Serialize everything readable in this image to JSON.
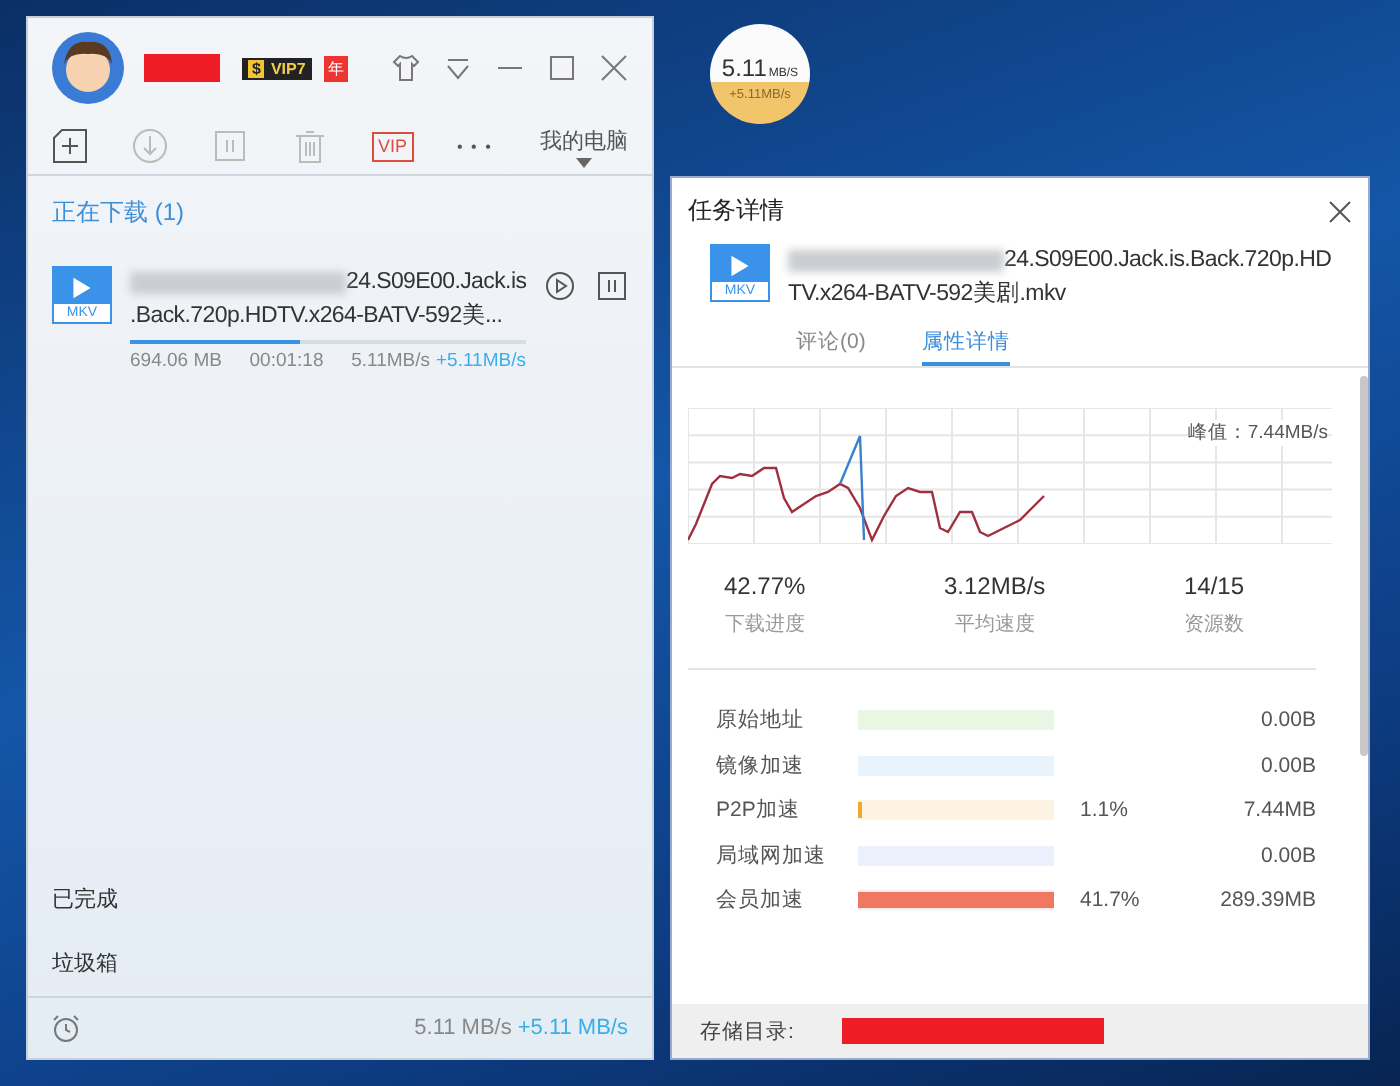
{
  "main_window": {
    "user": {
      "vip_symbol": "$",
      "vip_badge": "VIP7",
      "year_badge": "年"
    },
    "toolbar": {
      "vip_label": "VIP",
      "more": "• • •",
      "pc_label": "我的电脑"
    },
    "section_title": "正在下载 (1)",
    "task": {
      "file_type": "MKV",
      "name_line1": "24.S09E00.Jack.is",
      "name_line2": ".Back.720p.HDTV.x264-BATV-592美...",
      "level": 0.43,
      "size": "694.06 MB",
      "time": "00:01:18",
      "speed": "5.11MB/s",
      "boost": "+5.11MB/s"
    },
    "nav": [
      {
        "label": "已完成"
      },
      {
        "label": "垃圾箱"
      }
    ],
    "status_bar": {
      "speed": "5.11 MB/s",
      "boost": "+5.11 MB/s"
    }
  },
  "speed_orb": {
    "speed": "5.11",
    "unit": "MB/S",
    "boost": "+5.11MB/s"
  },
  "detail": {
    "title": "任务详情",
    "file_type": "MKV",
    "name_line1": "24.S09E00.Jack.is.Back.720p.HD",
    "name_line2": "TV.x264-BATV-592美剧.mkv",
    "tabs": [
      {
        "label": "评论(0)",
        "selected": false
      },
      {
        "label": "属性详情",
        "selected": true
      }
    ],
    "peak": "峰值：7.44MB/s",
    "stats": [
      {
        "value": "42.77%",
        "label": "下载进度"
      },
      {
        "value": "3.12MB/s",
        "label": "平均速度"
      },
      {
        "value": "14/15",
        "label": "资源数"
      }
    ],
    "sources": [
      {
        "label": "原始地址",
        "color": "#eaf6e4",
        "level": 0,
        "size": "0.00B"
      },
      {
        "label": "镜像加速",
        "color": "#e8f3fc",
        "level": 0,
        "size": "0.00B"
      },
      {
        "label": "P2P加速",
        "color": "#f0a830",
        "level": 0.02,
        "percent": "1.1%",
        "size": "7.44MB"
      },
      {
        "label": "局域网加速",
        "color": "#eceffc",
        "level": 0,
        "size": "0.00B"
      },
      {
        "label": "会员加速",
        "color": "#f07862",
        "level": 1,
        "percent": "41.7%",
        "size": "289.39MB"
      }
    ],
    "storage_label": "存储目录:"
  }
}
